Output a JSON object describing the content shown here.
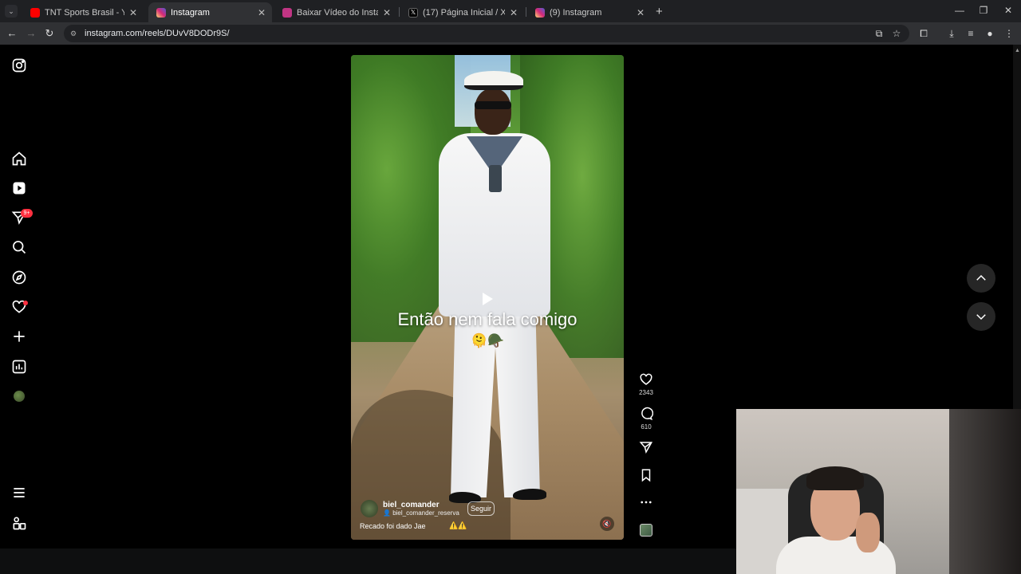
{
  "browser": {
    "tabs": [
      {
        "label": "TNT Sports Brasil - YouTube",
        "favicon_color": "#ff0000",
        "active": false
      },
      {
        "label": "Instagram",
        "favicon_color": "#d62976",
        "active": true
      },
      {
        "label": "Baixar Vídeo do Instagram - Sn",
        "favicon_color": "#c13584",
        "active": false
      },
      {
        "label": "(17) Página Inicial / X",
        "favicon_color": "#000000",
        "active": false
      },
      {
        "label": "(9) Instagram",
        "favicon_color": "#d62976",
        "active": false
      }
    ],
    "url": "instagram.com/reels/DUvV8DODr9S/"
  },
  "sidebar": {
    "notification_badge": "9+",
    "items": [
      "instagram-logo",
      "home",
      "reels",
      "messages",
      "search",
      "explore",
      "notifications",
      "create",
      "dashboard",
      "profile",
      "more",
      "meta"
    ]
  },
  "reel": {
    "overlay_text": "Então nem fala comigo",
    "overlay_emojis": "🫠🪖",
    "author_username": "biel_comander",
    "author_audio": "biel_comander_reserva",
    "follow_label": "Seguir",
    "description": "Recado foi dado Jae",
    "description_emojis": "⚠️⚠️",
    "likes": "2343",
    "comments": "610"
  },
  "colors": {
    "accent": "#ff3040",
    "background": "#000000"
  }
}
